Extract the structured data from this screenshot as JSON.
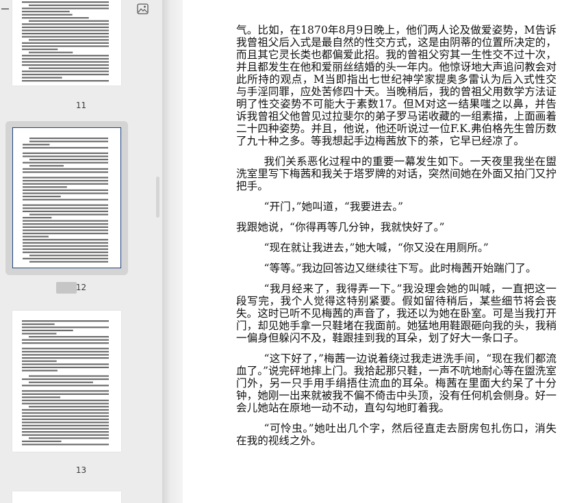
{
  "sidebar": {
    "zoom_level": 0.45,
    "thumbnails": [
      {
        "page_label": "11",
        "selected": false
      },
      {
        "page_label": "12",
        "selected": true
      },
      {
        "page_label": "13",
        "selected": false
      },
      {
        "page_label": "",
        "selected": false
      }
    ]
  },
  "document": {
    "paragraphs": [
      {
        "text": "气。比如，在1870年8月9日晚上，他们两人论及做爱姿势，M告诉我曾祖父后入式是最自然的性交方式，这是由阴蒂的位置所决定的，而且其它灵长类也都偏爱此招。我的曾祖父穷其一生性交不过十次，并且都发生在他和爱丽丝结婚的头一年内。他惊讶地大声追问教会对此所持的观点，M当即指出七世纪神学家提奥多雷认为后入式性交与手淫同罪，应处苦修四十天。当晚稍后，我的曾祖父用数学方法证明了性交姿势不可能大于素数17。但M对这一结果嗤之以鼻，并告诉我曾祖父他曾见过拉斐尔的弟子罗马诺收藏的一组素描，上面画着二十四种姿势。并且，他说，他还听说过一位F.K.弗伯格先生曾历数了九十种之多。等我想起手边梅茜放下的茶，它早已经凉了。",
        "indent": false
      },
      {
        "text": "我们关系恶化过程中的重要一幕发生如下。一天夜里我坐在盥洗室里写下梅茜和我关于塔罗牌的对话，突然间她在外面又拍门又拧把手。",
        "indent": true
      },
      {
        "text": "“开门，”她叫道，“我要进去。”",
        "indent": true
      },
      {
        "text": "我跟她说，“你得再等几分钟，我就快好了。”",
        "indent": false
      },
      {
        "text": "“现在就让我进去，”她大喊，“你又没在用厕所。”",
        "indent": true
      },
      {
        "text": "“等等。”我边回答边又继续往下写。此时梅茜开始踹门了。",
        "indent": true
      },
      {
        "text": "“我月经来了，我得弄一下。”我没理会她的叫喊，一直把这一段写完，我个人觉得这特别紧要。假如留待稍后，某些细节将会丧失。这时已听不见梅茜的声音了，我还以为她在卧室。可是当我打开门，却见她手拿一只鞋堵在我面前。她猛地用鞋跟砸向我的头，我稍一偏身但躲闪不及，鞋跟挂到我的耳朵，划了好大一条口子。",
        "indent": true
      },
      {
        "text": "“这下好了，”梅茜一边说着绕过我走进洗手间，“现在我们都流血了。”说完砰地摔上门。我拾起那只鞋，一声不吭地耐心等在盥洗室门外，另一只手用手绢捂住流血的耳朵。梅茜在里面大约呆了十分钟，她刚一出来就被我不偏不倚击中头顶，没有任何机会侧身。好一会儿她站在原地一动不动，直勾勾地盯着我。",
        "indent": true
      },
      {
        "text": "“可怜虫。”她吐出几个字，然后径直走去厨房包扎伤口，消失在我的视线之外。",
        "indent": true
      }
    ]
  },
  "colors": {
    "sidebar_bg": "#ececec",
    "selection_border": "#1f4480",
    "page_bg": "#ffffff"
  }
}
